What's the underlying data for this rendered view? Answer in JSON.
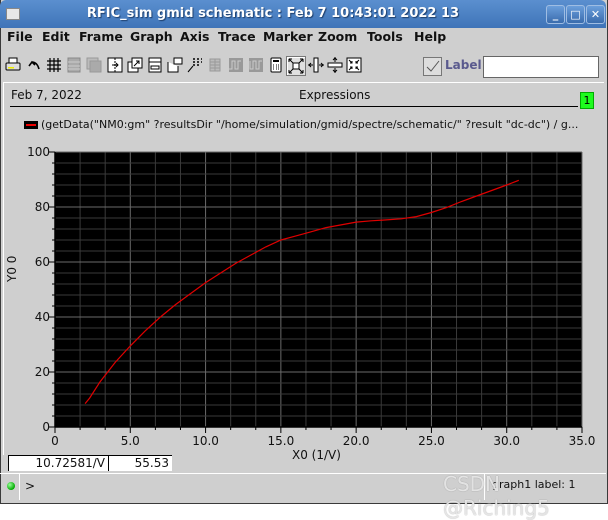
{
  "window": {
    "title": "RFIC_sim gmid schematic : Feb  7 10:43:01 2022 13",
    "buttons": {
      "minimize": "_",
      "maximize": "□",
      "close": "✕"
    }
  },
  "menubar": {
    "items": [
      {
        "label": "File"
      },
      {
        "label": "Edit"
      },
      {
        "label": "Frame"
      },
      {
        "label": "Graph"
      },
      {
        "label": "Axis"
      },
      {
        "label": "Trace"
      },
      {
        "label": "Marker"
      },
      {
        "label": "Zoom"
      },
      {
        "label": "Tools"
      },
      {
        "label": "Help"
      }
    ]
  },
  "toolbar": {
    "icons": [
      {
        "name": "print-icon",
        "enabled": true
      },
      {
        "name": "undo-icon",
        "enabled": true
      },
      {
        "name": "grid-icon",
        "enabled": true
      },
      {
        "name": "strips-icon",
        "enabled": false
      },
      {
        "name": "overlay-icon",
        "enabled": false
      },
      {
        "name": "split-icon",
        "enabled": true
      },
      {
        "name": "new-subwindow-icon",
        "enabled": true
      },
      {
        "name": "window-icon",
        "enabled": true
      },
      {
        "name": "detach-icon",
        "enabled": true
      },
      {
        "name": "marker-label-icon",
        "enabled": true
      },
      {
        "name": "table-icon",
        "enabled": false
      },
      {
        "name": "digital-wave-icon",
        "enabled": false
      },
      {
        "name": "bus-wave-icon",
        "enabled": false
      },
      {
        "name": "calculator-icon",
        "enabled": true
      },
      {
        "name": "fit-icon",
        "enabled": true,
        "pressed": true
      },
      {
        "name": "x-zoom-icon",
        "enabled": true
      },
      {
        "name": "y-zoom-icon",
        "enabled": true
      },
      {
        "name": "zoom-in-icon",
        "enabled": true
      }
    ],
    "label_checkbox_checked": true,
    "label_text": "Label",
    "label_input_value": ""
  },
  "header": {
    "date": "Feb 7, 2022",
    "title": "Expressions",
    "subwindow_badge": "1",
    "badge_color": "#1efb1e"
  },
  "legend": {
    "trace_text": "(getData(\"NM0:gm\" ?resultsDir \"/home/simulation/gmid/spectre/schematic/\" ?result \"dc-dc\") / g...",
    "trace_color": "#e00000"
  },
  "readout": {
    "x": "10.72581/V",
    "y": "55.53"
  },
  "status": {
    "prompt": ">",
    "graph_name": "graph1 label: 1",
    "watermark": "CSDN @Riching5"
  },
  "chart_data": {
    "type": "line",
    "title": "",
    "xlabel": "X0 (1/V)",
    "ylabel": "Y0 0",
    "xlim": [
      0,
      35
    ],
    "ylim": [
      0,
      100
    ],
    "x_ticks": [
      "0",
      "5.0",
      "10.0",
      "15.0",
      "20.0",
      "25.0",
      "30.0",
      "35.0"
    ],
    "y_ticks": [
      "0",
      "20",
      "40",
      "60",
      "80",
      "100"
    ],
    "x_tick_values": [
      0,
      5,
      10,
      15,
      20,
      25,
      30,
      35
    ],
    "y_tick_values": [
      0,
      20,
      40,
      60,
      80,
      100
    ],
    "grid": true,
    "background": "#000000",
    "grid_color": "#3a3a3a",
    "major_grid_color": "#6a6a6a",
    "series": [
      {
        "name": "getData(\"NM0:gm\") / g...",
        "color": "#e00000",
        "x": [
          2.0,
          2.3,
          3.0,
          4.0,
          5.0,
          6.0,
          7.0,
          8.0,
          9.0,
          10.0,
          11.0,
          12.0,
          13.0,
          14.0,
          15.0,
          16.0,
          17.0,
          18.0,
          19.0,
          20.0,
          21.0,
          22.0,
          23.0,
          24.0,
          25.0,
          26.0,
          27.0,
          28.0,
          29.0,
          30.0,
          30.8
        ],
        "y": [
          8.5,
          10.5,
          16.5,
          23.5,
          29.5,
          35.0,
          40.0,
          44.5,
          48.5,
          52.5,
          56.0,
          59.5,
          62.5,
          65.5,
          68.0,
          69.5,
          71.0,
          72.5,
          73.5,
          74.5,
          75.0,
          75.3,
          75.7,
          76.5,
          78.0,
          79.8,
          82.0,
          84.0,
          86.0,
          88.0,
          89.7
        ]
      }
    ]
  }
}
